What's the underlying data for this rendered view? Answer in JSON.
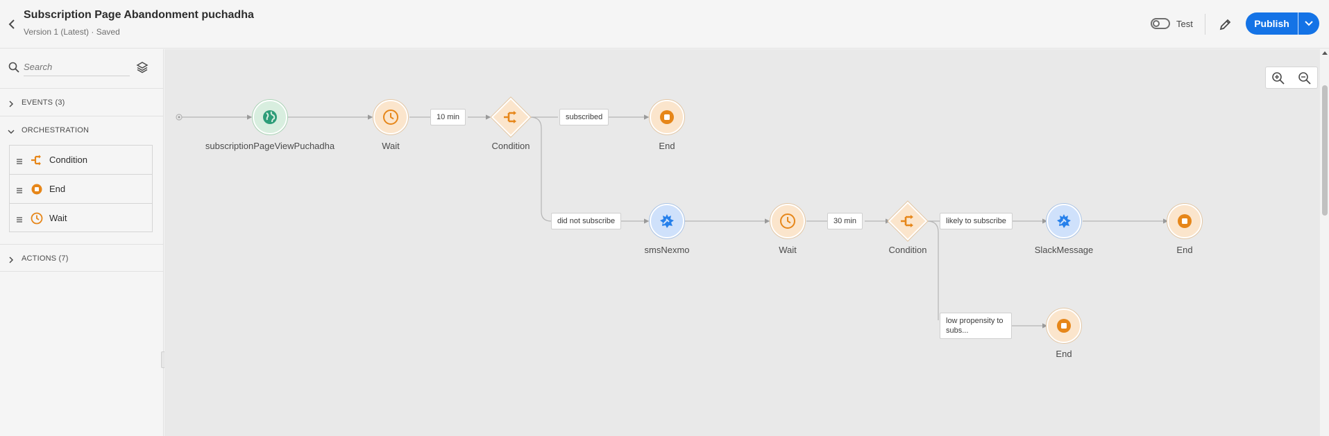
{
  "header": {
    "title": "Subscription Page Abandonment puchadha",
    "subtitle": "Version 1 (Latest) · Saved",
    "test_label": "Test",
    "publish_label": "Publish"
  },
  "sidebar": {
    "search_placeholder": "Search",
    "sections": {
      "events": "EVENTS (3)",
      "orchestration": "ORCHESTRATION",
      "actions": "ACTIONS (7)"
    },
    "orchestration_items": [
      {
        "label": "Condition",
        "icon": "condition-icon"
      },
      {
        "label": "End",
        "icon": "end-icon"
      },
      {
        "label": "Wait",
        "icon": "wait-icon"
      }
    ]
  },
  "canvas": {
    "nodes": {
      "event": "subscriptionPageViewPuchadha",
      "wait1": "Wait",
      "condition1": "Condition",
      "end1": "End",
      "sms": "smsNexmo",
      "wait2": "Wait",
      "condition2": "Condition",
      "slack": "SlackMessage",
      "end2": "End",
      "end3": "End"
    },
    "edges": {
      "wait1_duration": "10 min",
      "subscribed": "subscribed",
      "did_not_subscribe": "did not subscribe",
      "wait2_duration": "30 min",
      "likely": "likely to subscribe",
      "low": "low propensity to subs..."
    }
  },
  "colors": {
    "accent": "#1473e6",
    "orchestration": "#e68619",
    "action": "#2680eb",
    "event": "#2d9d78"
  }
}
